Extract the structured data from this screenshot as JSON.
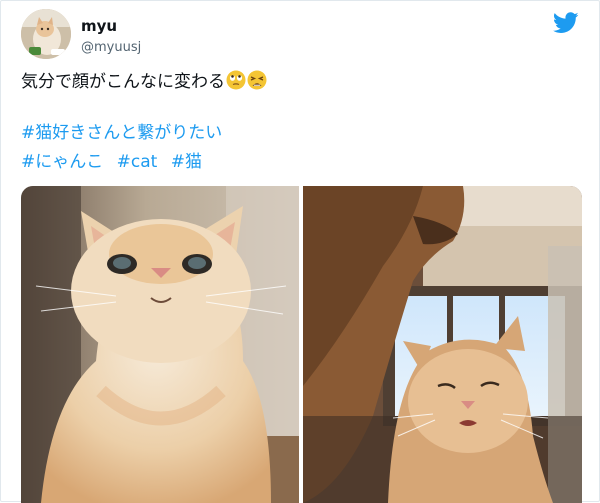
{
  "user": {
    "display_name": "myu",
    "handle": "@myuusj",
    "avatar_icon": "cat-avatar"
  },
  "tweet": {
    "text": "気分で顔がこんなに変わる",
    "emojis": [
      "face-with-rolling-eyes",
      "tired-face"
    ],
    "hashtags": [
      [
        "#猫好きさんと繋がりたい"
      ],
      [
        "#にゃんこ",
        "#cat",
        "#猫"
      ]
    ]
  },
  "media": {
    "photos": [
      {
        "name": "photo-cat-looking-up"
      },
      {
        "name": "photo-cats-squinting"
      }
    ]
  },
  "colors": {
    "link": "#1d9bf0",
    "twitter_blue": "#1d9bf0",
    "handle_gray": "#536471",
    "emoji_yellow": "#f4c534"
  }
}
